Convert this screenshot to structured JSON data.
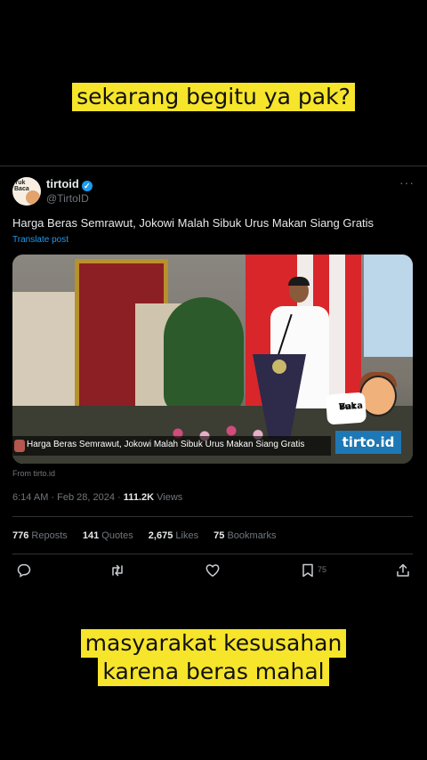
{
  "captions": {
    "top": "sekarang begitu ya pak?",
    "bottom_line1": "masyarakat kesusahan",
    "bottom_line2": "karena beras mahal"
  },
  "tweet": {
    "display_name": "tirtoid",
    "handle": "@TirtoID",
    "avatar_text": "Yuk Baca",
    "more_label": "···",
    "text": "Harga Beras Semrawut, Jokowi Malah Sibuk Urus Makan Siang Gratis",
    "translate_label": "Translate post",
    "media": {
      "headline": "Harga Beras Semrawut, Jokowi Malah Sibuk Urus Makan Siang Gratis",
      "logo_card_text_1": "Yuk",
      "logo_card_text_2": "Baca",
      "brand": "tirto.id"
    },
    "from": "From tirto.id",
    "time": "6:14 AM",
    "separator": "·",
    "date": "Feb 28, 2024",
    "views_count": "111.2K",
    "views_label": "Views",
    "stats": {
      "reposts_count": "776",
      "reposts_label": "Reposts",
      "quotes_count": "141",
      "quotes_label": "Quotes",
      "likes_count": "2,675",
      "likes_label": "Likes",
      "bookmarks_count": "75",
      "bookmarks_label": "Bookmarks"
    },
    "actions": {
      "bookmark_count": "75"
    }
  },
  "colors": {
    "caption_bg": "#f6e52a",
    "background": "#000000",
    "accent": "#1d9bf0",
    "text_primary": "#e7e9ea",
    "text_secondary": "#71767b"
  },
  "icons": [
    "verified-badge-icon",
    "more-icon",
    "reply-icon",
    "repost-icon",
    "like-icon",
    "bookmark-icon",
    "share-icon"
  ]
}
